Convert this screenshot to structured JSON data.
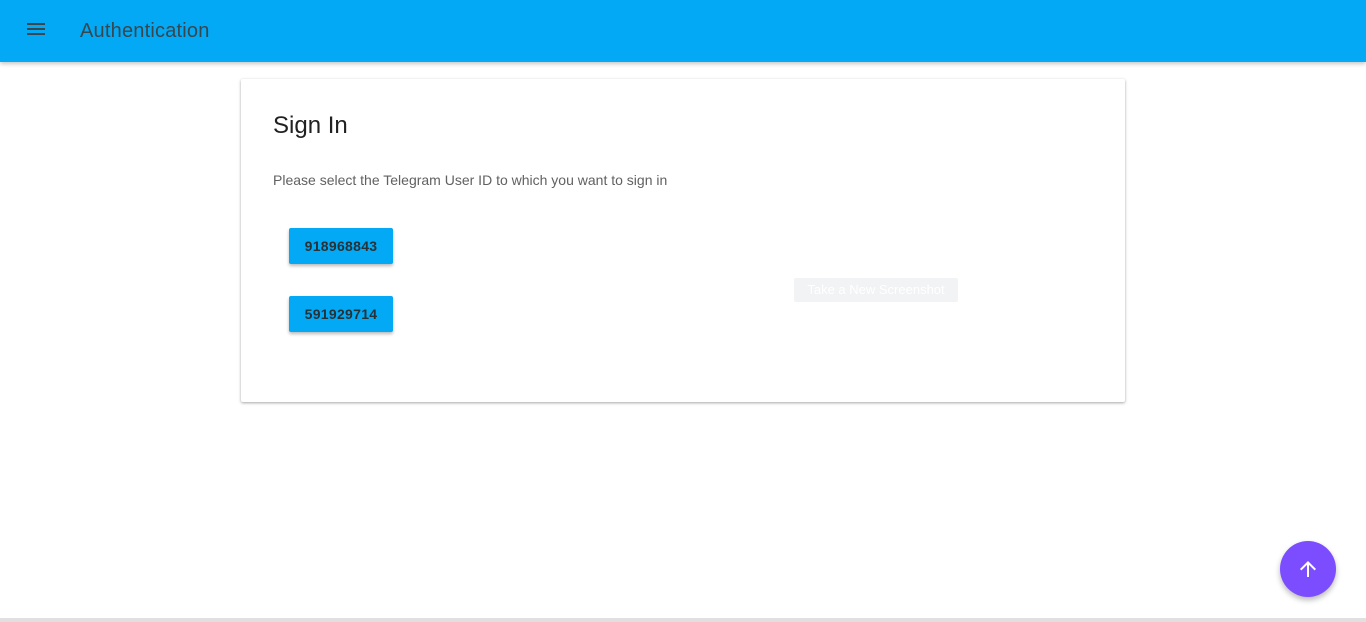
{
  "app_bar": {
    "title": "Authentication",
    "menu_icon": "menu-icon",
    "color": "#03a9f4"
  },
  "sign_in_card": {
    "title": "Sign In",
    "description": "Please select the Telegram User ID to which you want to sign in",
    "user_ids": [
      "918968843",
      "591929714"
    ]
  },
  "tooltip": {
    "text": "Take a New Screenshot"
  },
  "fab": {
    "icon": "arrow-up-icon",
    "color": "#7c4dff"
  }
}
